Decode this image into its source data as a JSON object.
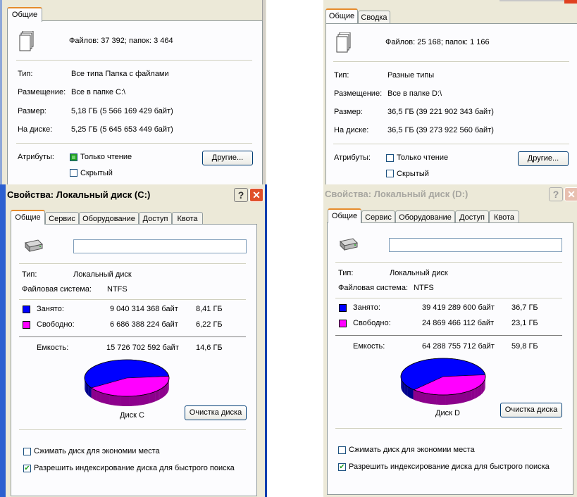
{
  "top_left": {
    "tab": "Общие",
    "files_folders": "Файлов: 37 392; папок: 3 464",
    "rows": [
      {
        "label": "Тип:",
        "value": "Все типа Папка с файлами"
      },
      {
        "label": "Размещение:",
        "value": "Все в папке C:\\"
      },
      {
        "label": "Размер:",
        "value": "5,18 ГБ (5 566 169 429 байт)"
      },
      {
        "label": "На диске:",
        "value": "5,25 ГБ (5 645 653 449 байт)"
      }
    ],
    "attributes_label": "Атрибуты:",
    "readonly_label": "Только чтение",
    "hidden_label": "Скрытый",
    "other_button": "Другие..."
  },
  "top_right": {
    "tabs": [
      "Общие",
      "Сводка"
    ],
    "files_folders": "Файлов: 25 168; папок: 1 166",
    "rows": [
      {
        "label": "Тип:",
        "value": "Разные типы"
      },
      {
        "label": "Размещение:",
        "value": "Все в папке D:\\"
      },
      {
        "label": "Размер:",
        "value": "36,5 ГБ (39 221 902 343 байт)"
      },
      {
        "label": "На диске:",
        "value": "36,5 ГБ (39 273 922 560 байт)"
      }
    ],
    "attributes_label": "Атрибуты:",
    "readonly_label": "Только чтение",
    "hidden_label": "Скрытый",
    "other_button": "Другие..."
  },
  "disk_c": {
    "title": "Свойства: Локальный диск (C:)",
    "help_button": "?",
    "close_button": "✕",
    "tabs": [
      "Общие",
      "Сервис",
      "Оборудование",
      "Доступ",
      "Квота"
    ],
    "name_value": "",
    "type_label": "Тип:",
    "type_value": "Локальный диск",
    "fs_label": "Файловая система:",
    "fs_value": "NTFS",
    "used_label": "Занято:",
    "used_bytes": "9 040 314 368 байт",
    "used_gb": "8,41 ГБ",
    "free_label": "Свободно:",
    "free_bytes": "6 686 388 224 байт",
    "free_gb": "6,22 ГБ",
    "capacity_label": "Емкость:",
    "capacity_bytes": "15 726 702 592 байт",
    "capacity_gb": "14,6 ГБ",
    "disk_label": "Диск C",
    "cleanup_button": "Очистка диска",
    "compress_label": "Сжимать диск для экономии места",
    "index_label": "Разрешить индексирование диска для быстрого поиска",
    "compress_checked": false,
    "index_checked": true,
    "used_fraction": 0.575,
    "colors": {
      "used": "#0000ff",
      "free": "#ff00ff"
    }
  },
  "disk_d": {
    "title": "Свойства: Локальный диск (D:)",
    "help_button": "?",
    "close_button": "✕",
    "tabs": [
      "Общие",
      "Сервис",
      "Оборудование",
      "Доступ",
      "Квота"
    ],
    "name_value": "",
    "type_label": "Тип:",
    "type_value": "Локальный диск",
    "fs_label": "Файловая система:",
    "fs_value": "NTFS",
    "used_label": "Занято:",
    "used_bytes": "39 419 289 600 байт",
    "used_gb": "36,7 ГБ",
    "free_label": "Свободно:",
    "free_bytes": "24 869 466 112 байт",
    "free_gb": "23,1 ГБ",
    "capacity_label": "Емкость:",
    "capacity_bytes": "64 288 755 712 байт",
    "capacity_gb": "59,8 ГБ",
    "disk_label": "Диск D",
    "cleanup_button": "Очистка диска",
    "compress_label": "Сжимать диск для экономии места",
    "index_label": "Разрешить индексирование диска для быстрого поиска",
    "compress_checked": false,
    "index_checked": true,
    "used_fraction": 0.613,
    "colors": {
      "used": "#0000ff",
      "free": "#ff00ff"
    }
  }
}
